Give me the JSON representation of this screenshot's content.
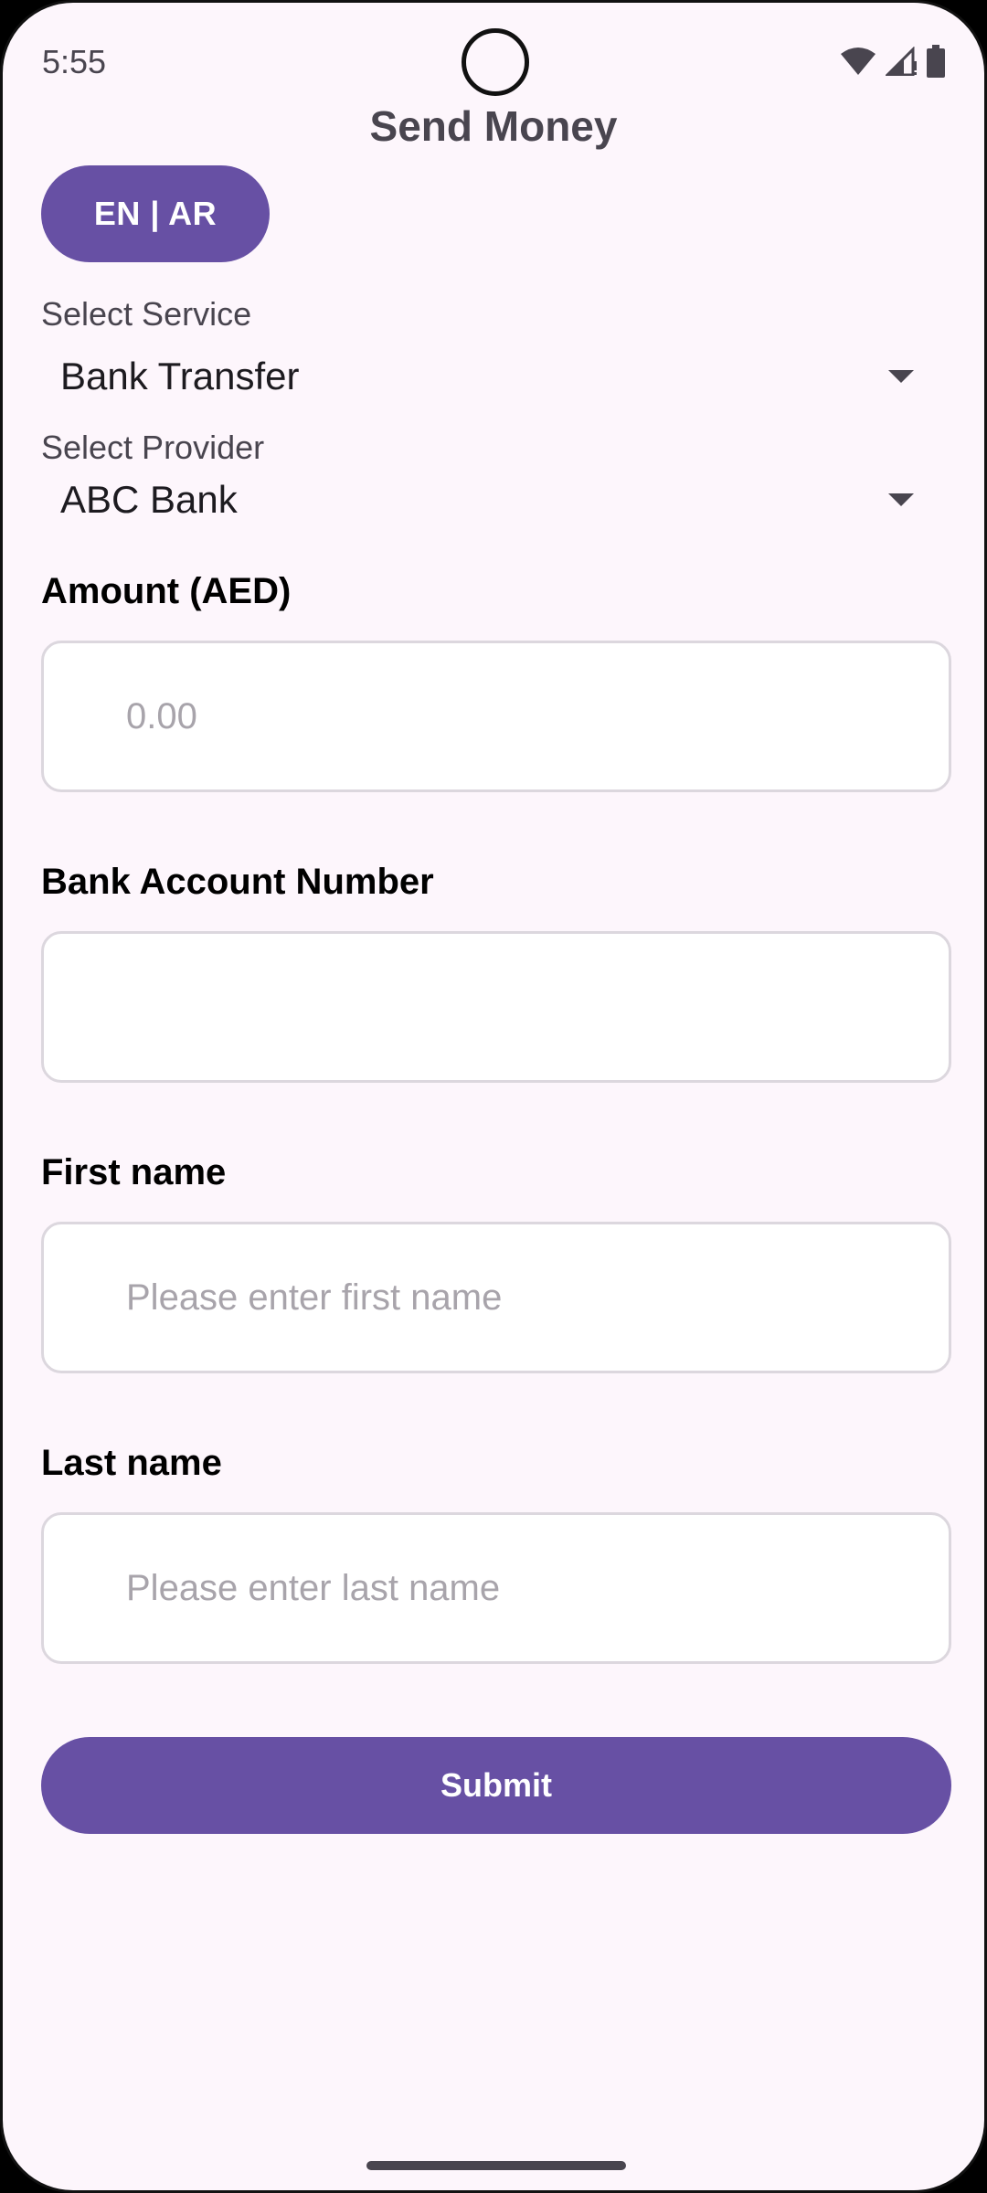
{
  "status_bar": {
    "time": "5:55",
    "icons": [
      "wifi-icon",
      "signal-icon",
      "battery-icon"
    ]
  },
  "header": {
    "title": "Send Money",
    "language_toggle": "EN | AR"
  },
  "form": {
    "service": {
      "label": "Select Service",
      "value": "Bank Transfer"
    },
    "provider": {
      "label": "Select Provider",
      "value": "ABC Bank"
    },
    "amount": {
      "label": "Amount (AED)",
      "value": "",
      "placeholder": "0.00"
    },
    "account_number": {
      "label": "Bank Account Number",
      "value": "",
      "placeholder": ""
    },
    "first_name": {
      "label": "First name",
      "value": "",
      "placeholder": "Please enter first name"
    },
    "last_name": {
      "label": "Last name",
      "value": "",
      "placeholder": "Please enter last name"
    },
    "submit_label": "Submit"
  },
  "colors": {
    "primary": "#6750a4",
    "background": "#fdf6fc",
    "field_border": "#dcd7de",
    "placeholder": "#a8a4ab"
  }
}
